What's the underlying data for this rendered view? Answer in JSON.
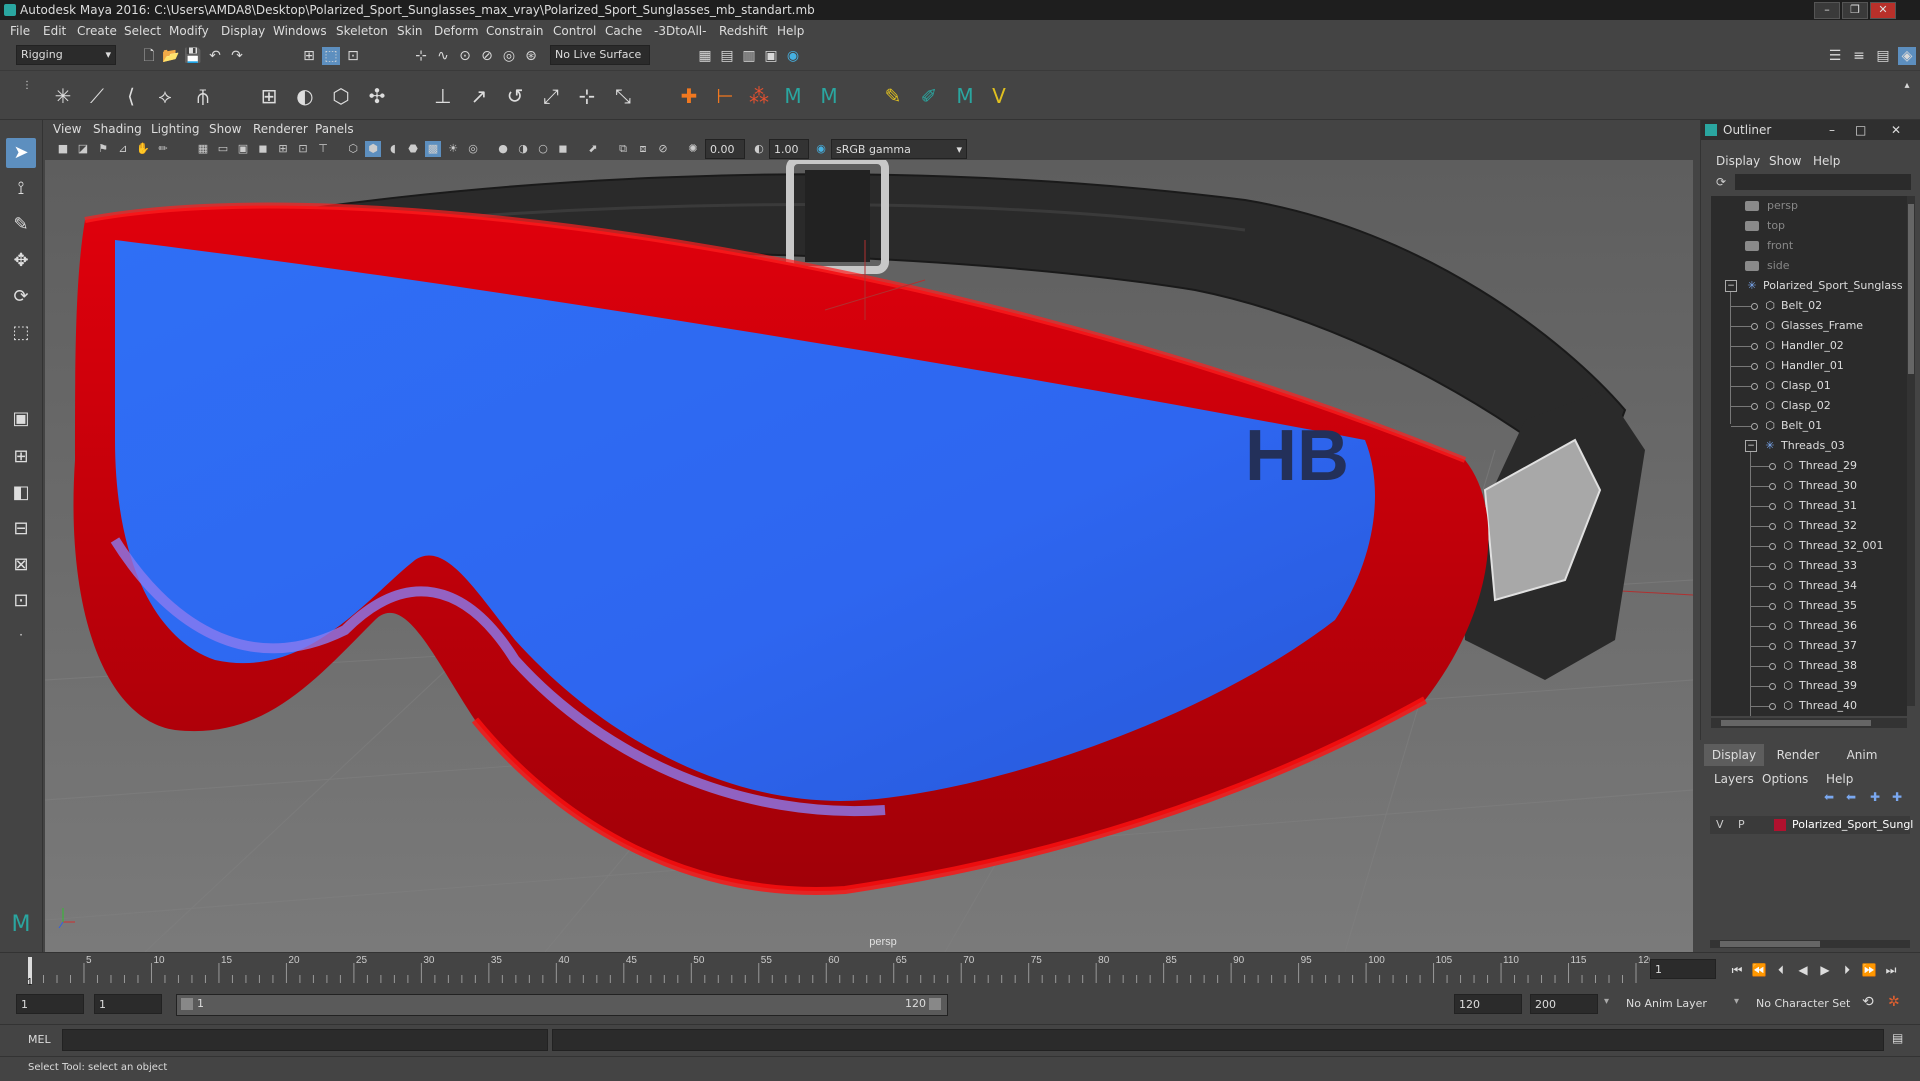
{
  "window": {
    "title": "Autodesk Maya 2016: C:\\Users\\AMDA8\\Desktop\\Polarized_Sport_Sunglasses_max_vray\\Polarized_Sport_Sunglasses_mb_standart.mb",
    "min": "–",
    "max": "❐",
    "close": "✕"
  },
  "menu": [
    "File",
    "Edit",
    "Create",
    "Select",
    "Modify",
    "Display",
    "Windows",
    "Skeleton",
    "Skin",
    "Deform",
    "Constrain",
    "Control",
    "Cache",
    "-3DtoAll-",
    "Redshift",
    "Help"
  ],
  "menuset": "Rigging",
  "live_surface": "No Live Surface",
  "viewport": {
    "menus": [
      "View",
      "Shading",
      "Lighting",
      "Show",
      "Renderer",
      "Panels"
    ],
    "near_value": "0.00",
    "far_value": "1.00",
    "color_space": "sRGB gamma",
    "camera_label": "persp",
    "logo_text": "HB"
  },
  "outliner": {
    "title": "Outliner",
    "menus": [
      "Display",
      "Show",
      "Help"
    ],
    "cameras": [
      "persp",
      "top",
      "front",
      "side"
    ],
    "root": "Polarized_Sport_Sunglass",
    "children": [
      "Belt_02",
      "Glasses_Frame",
      "Handler_02",
      "Handler_01",
      "Clasp_01",
      "Clasp_02",
      "Belt_01"
    ],
    "group": "Threads_03",
    "threads": [
      "Thread_29",
      "Thread_30",
      "Thread_31",
      "Thread_32",
      "Thread_32_001",
      "Thread_33",
      "Thread_34",
      "Thread_35",
      "Thread_36",
      "Thread_37",
      "Thread_38",
      "Thread_39",
      "Thread_40"
    ]
  },
  "layers": {
    "tabs": [
      "Display",
      "Render",
      "Anim"
    ],
    "menus": [
      "Layers",
      "Options",
      "Help"
    ],
    "layer_v": "V",
    "layer_p": "P",
    "layer_name": "Polarized_Sport_Sungl",
    "layer_color": "#b0112e"
  },
  "timeline": {
    "ticks": [
      "1",
      "5",
      "10",
      "15",
      "20",
      "25",
      "30",
      "35",
      "40",
      "45",
      "50",
      "55",
      "60",
      "65",
      "70",
      "75",
      "80",
      "85",
      "90",
      "95",
      "100",
      "105",
      "110",
      "115",
      "120"
    ],
    "tick_values": [
      1,
      5,
      10,
      15,
      20,
      25,
      30,
      35,
      40,
      45,
      50,
      55,
      60,
      65,
      70,
      75,
      80,
      85,
      90,
      95,
      100,
      105,
      110,
      115,
      120
    ],
    "current_frame": "1"
  },
  "range": {
    "start": "1",
    "playback_start": "1",
    "slider_start": "1",
    "slider_end": "120",
    "playback_end": "120",
    "end": "200",
    "anim_layer": "No Anim Layer",
    "char_set": "No Character Set"
  },
  "command": {
    "label": "MEL"
  },
  "status": {
    "text": "Select Tool: select an object"
  },
  "colors": {
    "accent": "#5d8fbf",
    "frame_red": "#c8000a",
    "lens_blue": "#2e6af0"
  }
}
